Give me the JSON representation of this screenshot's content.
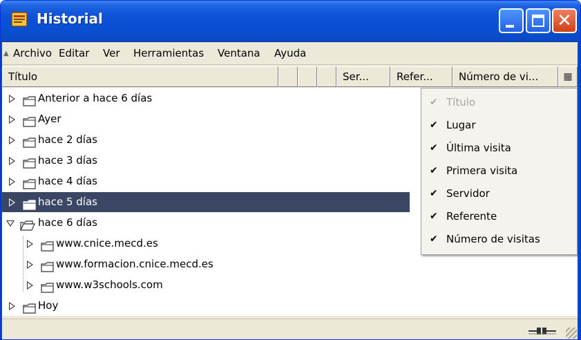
{
  "window": {
    "title": "Historial"
  },
  "menu": {
    "items": [
      "Archivo",
      "Editar",
      "Ver",
      "Herramientas",
      "Ventana",
      "Ayuda"
    ]
  },
  "columns": {
    "titulo": "Título",
    "servidor": "Ser...",
    "referente": "Refer...",
    "numero": "Número de vi..."
  },
  "tree": {
    "items": [
      "Anterior a hace 6 días",
      "Ayer",
      "hace 2 días",
      "hace 3 días",
      "hace 4 días",
      "hace 5 días",
      "hace 6 días",
      "www.cnice.mecd.es",
      "www.formacion.cnice.mecd.es",
      "www.w3schools.com",
      "Hoy"
    ],
    "selected": "hace 5 días",
    "expanded": "hace 6 días"
  },
  "column_menu": {
    "items": [
      {
        "label": "Título",
        "checked": true,
        "enabled": false
      },
      {
        "label": "Lugar",
        "checked": true,
        "enabled": true
      },
      {
        "label": "Última visita",
        "checked": true,
        "enabled": true
      },
      {
        "label": "Primera visita",
        "checked": true,
        "enabled": true
      },
      {
        "label": "Servidor",
        "checked": true,
        "enabled": true
      },
      {
        "label": "Referente",
        "checked": true,
        "enabled": true
      },
      {
        "label": "Número de visitas",
        "checked": true,
        "enabled": true
      }
    ],
    "check_glyph": "✔"
  },
  "colors": {
    "titlebar": "#0b52d6",
    "selection": "#3a4663",
    "chrome": "#ece9d8"
  },
  "icons": [
    "app-icon",
    "minimize-icon",
    "maximize-icon",
    "close-icon",
    "folder-icon",
    "expand-arrow-icon",
    "column-picker-icon",
    "online-status-icon"
  ]
}
